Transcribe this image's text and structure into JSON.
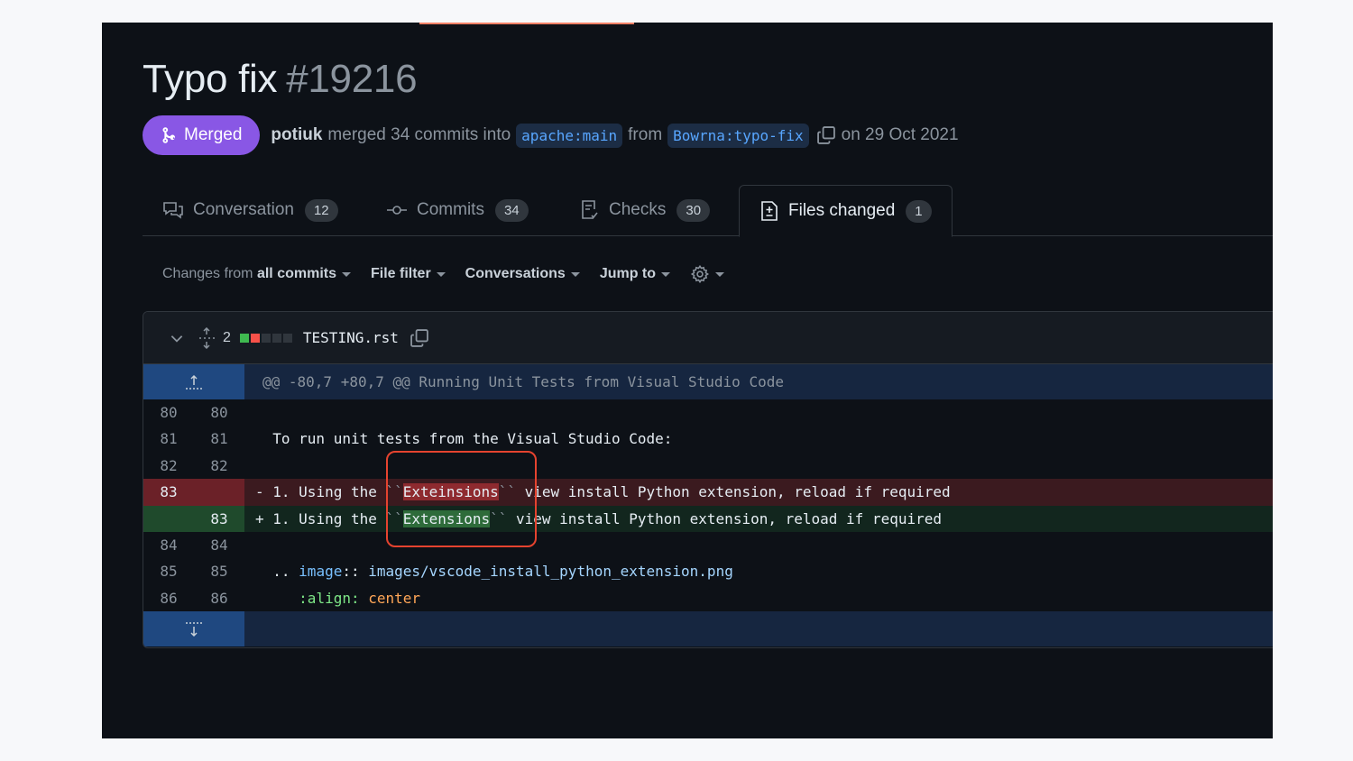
{
  "pr": {
    "title": "Typo fix",
    "number": "#19216",
    "status": "Merged",
    "author": "potiuk",
    "merged_text": "merged 34 commits into",
    "base_branch": "apache:main",
    "from_text": "from",
    "head_branch": "Bowrna:typo-fix",
    "date_text": "on 29 Oct 2021"
  },
  "tabs": [
    {
      "label": "Conversation",
      "count": "12",
      "icon": "comment-discussion-icon"
    },
    {
      "label": "Commits",
      "count": "34",
      "icon": "git-commit-icon"
    },
    {
      "label": "Checks",
      "count": "30",
      "icon": "checklist-icon"
    },
    {
      "label": "Files changed",
      "count": "1",
      "icon": "file-diff-icon",
      "active": true
    }
  ],
  "toolbar": {
    "changes_prefix": "Changes from",
    "changes_value": "all commits",
    "file_filter": "File filter",
    "conversations": "Conversations",
    "jump_to": "Jump to",
    "settings_icon": "gear-icon"
  },
  "file": {
    "changes_count": "2",
    "name": "TESTING.rst",
    "diffstat": [
      "added",
      "deleted",
      "neutral",
      "neutral",
      "neutral"
    ]
  },
  "diff": {
    "hunk_header": "@@ -80,7 +80,7 @@ Running Unit Tests from Visual Studio Code",
    "lines": [
      {
        "old": "80",
        "new": "80",
        "type": "context",
        "text": ""
      },
      {
        "old": "81",
        "new": "81",
        "type": "context",
        "text": "  To run unit tests from the Visual Studio Code:"
      },
      {
        "old": "82",
        "new": "82",
        "type": "context",
        "text": ""
      },
      {
        "old": "83",
        "new": "",
        "type": "deleted",
        "marker": "-",
        "pre": " 1. Using the ",
        "tick1": "``",
        "word": "Exteinsions",
        "tick2": "``",
        "post": " view install Python extension, reload if required"
      },
      {
        "old": "",
        "new": "83",
        "type": "added",
        "marker": "+",
        "pre": " 1. Using the ",
        "tick1": "``",
        "word": "Extensions",
        "tick2": "``",
        "post": " view install Python extension, reload if required"
      },
      {
        "old": "84",
        "new": "84",
        "type": "context",
        "text": ""
      },
      {
        "old": "85",
        "new": "85",
        "type": "context",
        "pre": "  .. ",
        "directive": "image",
        "sep": ":: ",
        "path": "images/vscode_install_python_extension.png"
      },
      {
        "old": "86",
        "new": "86",
        "type": "context",
        "pre": "     ",
        "option": ":align:",
        "value": " center"
      }
    ]
  },
  "colors": {
    "merged": "#8957e5",
    "deleted_bg": "#3b1a1f",
    "added_bg": "#12261e",
    "highlight_box": "#e5432f"
  }
}
